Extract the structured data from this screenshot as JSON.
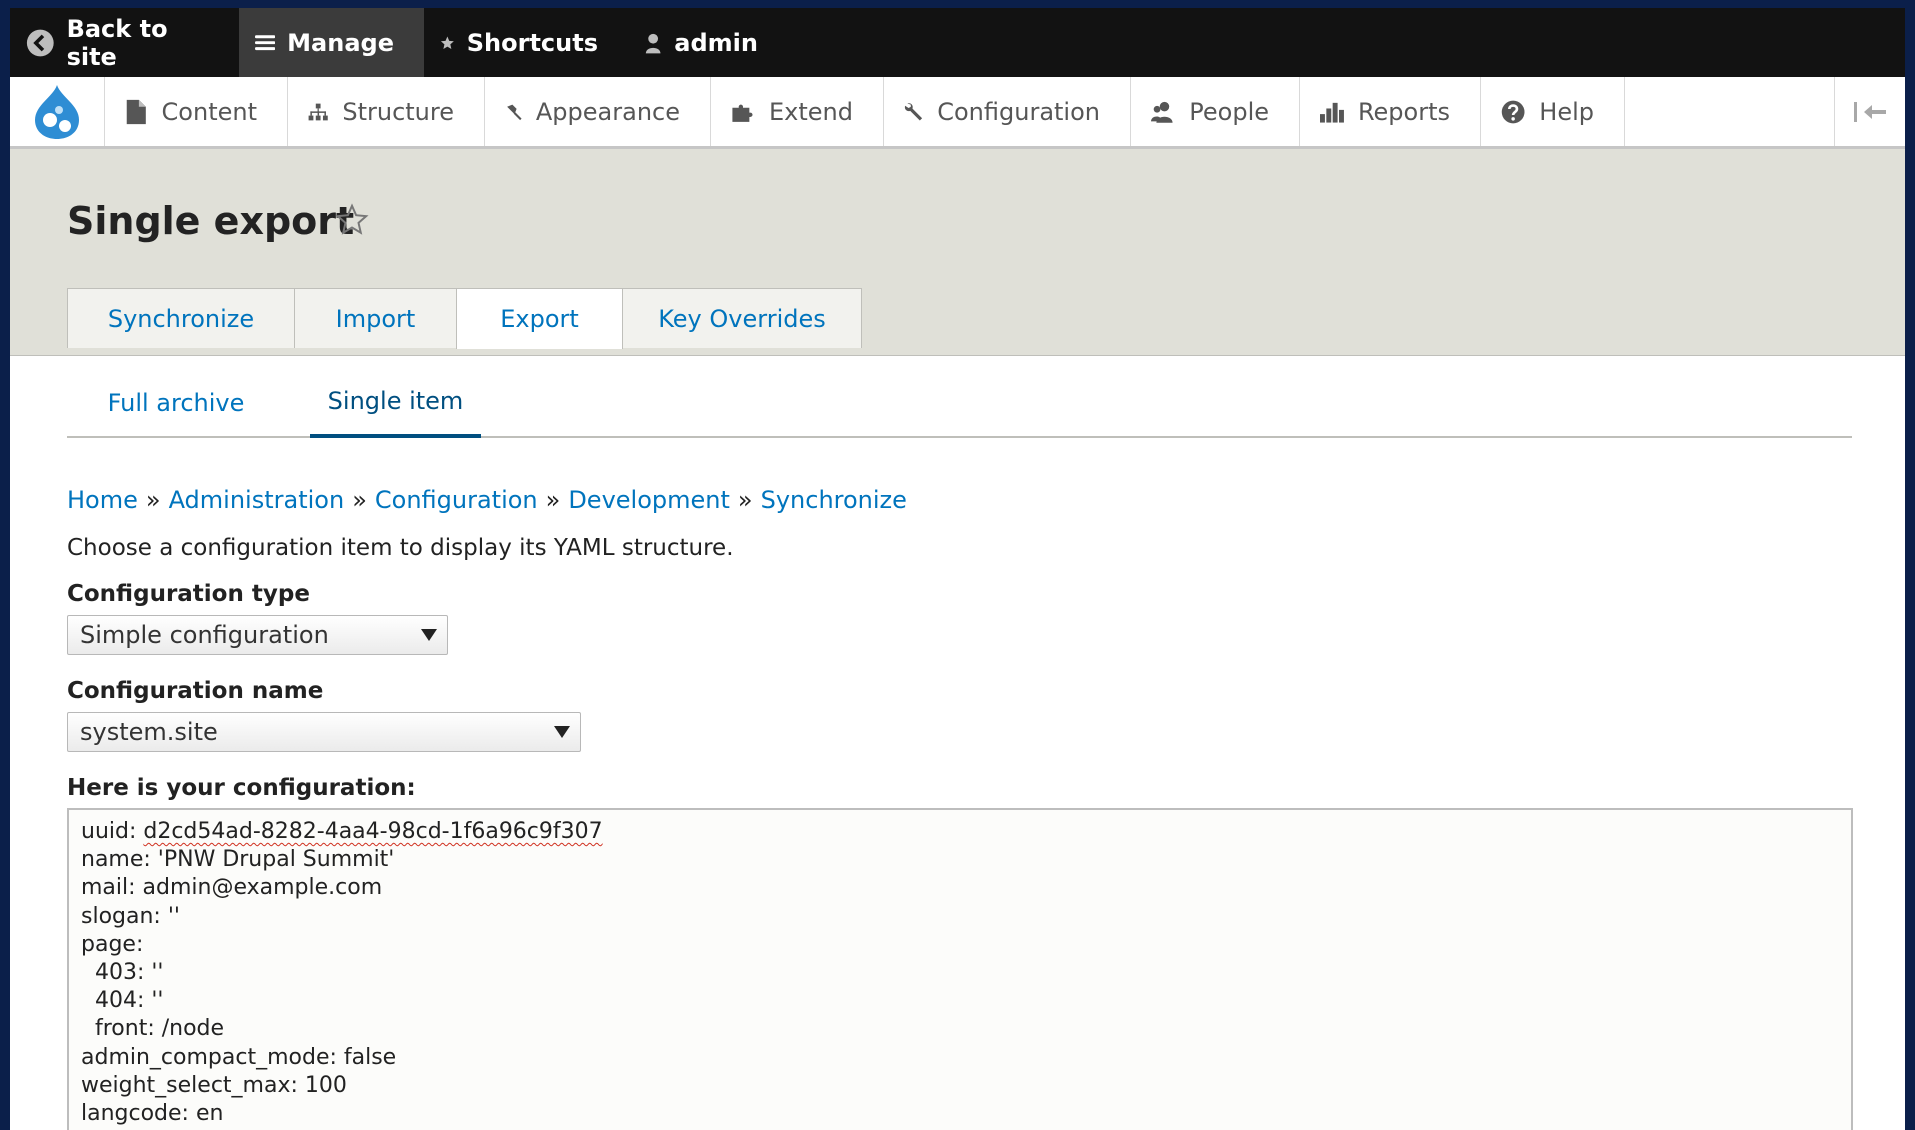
{
  "toolbar": {
    "back_label": "Back to site",
    "manage_label": "Manage",
    "shortcuts_label": "Shortcuts",
    "user_label": "admin"
  },
  "tray": {
    "items": [
      {
        "label": "Content",
        "icon": "page-icon"
      },
      {
        "label": "Structure",
        "icon": "sitemap-icon"
      },
      {
        "label": "Appearance",
        "icon": "paintbrush-icon"
      },
      {
        "label": "Extend",
        "icon": "puzzle-icon"
      },
      {
        "label": "Configuration",
        "icon": "wrench-icon"
      },
      {
        "label": "People",
        "icon": "people-icon"
      },
      {
        "label": "Reports",
        "icon": "bar-chart-icon"
      },
      {
        "label": "Help",
        "icon": "help-icon"
      }
    ]
  },
  "page": {
    "title": "Single export"
  },
  "tabs": [
    {
      "label": "Synchronize",
      "active": false
    },
    {
      "label": "Import",
      "active": false
    },
    {
      "label": "Export",
      "active": true
    },
    {
      "label": "Key Overrides",
      "active": false
    }
  ],
  "subtabs": [
    {
      "label": "Full archive",
      "active": false
    },
    {
      "label": "Single item",
      "active": true
    }
  ],
  "breadcrumb": [
    "Home",
    "Administration",
    "Configuration",
    "Development",
    "Synchronize"
  ],
  "breadcrumb_separator": "»",
  "description": "Choose a configuration item to display its YAML structure.",
  "form": {
    "type_label": "Configuration type",
    "type_value": "Simple configuration",
    "name_label": "Configuration name",
    "name_value": "system.site",
    "config_label": "Here is your configuration:"
  },
  "config": {
    "uuid_key": "uuid: ",
    "uuid_value": "d2cd54ad-8282-4aa4-98cd-1f6a96c9f307",
    "lines": [
      "name: 'PNW Drupal Summit'",
      "mail: admin@example.com",
      "slogan: ''",
      "page:",
      "  403: ''",
      "  404: ''",
      "  front: /node",
      "admin_compact_mode: false",
      "weight_select_max: 100",
      "langcode: en"
    ]
  },
  "colors": {
    "link": "#0074bd",
    "toolbar_bg": "#121212",
    "header_bg": "#e0e0d8",
    "page_bg": "#0b1f4a"
  }
}
